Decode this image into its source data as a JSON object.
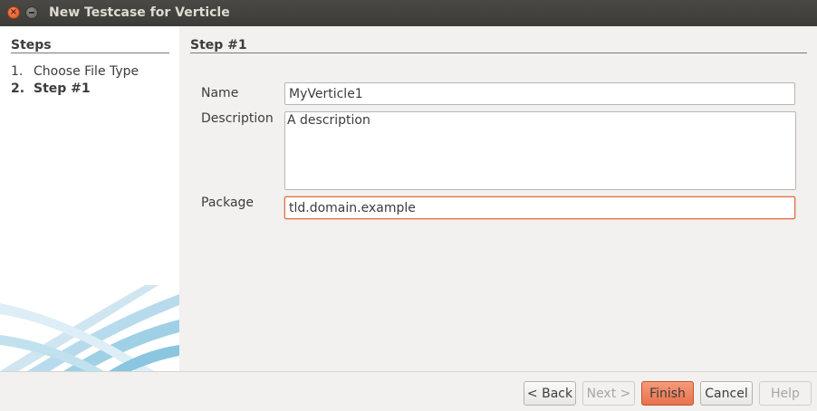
{
  "window": {
    "title": "New Testcase for Verticle",
    "close_symbol": "×"
  },
  "sidebar": {
    "title": "Steps",
    "steps": [
      {
        "number": "1.",
        "label": "Choose File Type"
      },
      {
        "number": "2.",
        "label": "Step #1"
      }
    ]
  },
  "main": {
    "header": "Step #1",
    "fields": {
      "name": {
        "label": "Name",
        "value": "MyVerticle1"
      },
      "description": {
        "label": "Description",
        "value": "A description"
      },
      "package": {
        "label": "Package",
        "value": "tld.domain.example"
      }
    }
  },
  "buttons": {
    "back": "< Back",
    "next": "Next >",
    "finish": "Finish",
    "cancel": "Cancel",
    "help": "Help"
  },
  "colors": {
    "accent": "#e8734e",
    "titlebar": "#3c3b37"
  }
}
